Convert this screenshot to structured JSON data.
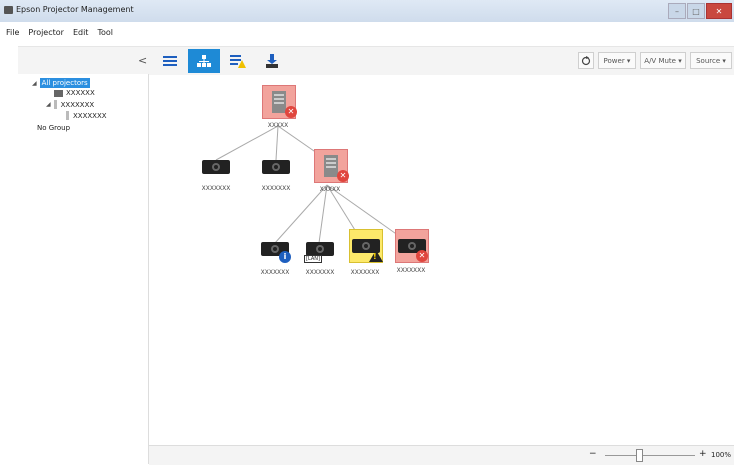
{
  "window": {
    "title": "Epson Projector Management"
  },
  "menu": [
    "File",
    "Projector",
    "Edit",
    "Tool"
  ],
  "toolbar": {
    "collapse_glyph": "<",
    "views": [
      "list-view-icon",
      "topology-view-icon",
      "alert-view-icon",
      "download-icon"
    ],
    "power": "Power ▾",
    "av_mute": "A/V Mute ▾",
    "source": "Source ▾"
  },
  "sidebar": {
    "root": "All projectors",
    "items": [
      {
        "label": "XXXXXX"
      },
      {
        "label": "XXXXXXX"
      },
      {
        "label": "XXXXXXX"
      }
    ],
    "no_group": "No Group"
  },
  "topology": {
    "nodes": [
      {
        "label": "XXXXX"
      },
      {
        "label": "XXXXXXX"
      },
      {
        "label": "XXXXXXX"
      },
      {
        "label": "XXXXX"
      },
      {
        "label": "XXXXXXX"
      },
      {
        "label": "XXXXXXX",
        "badge": "[LAN]"
      },
      {
        "label": "XXXXXXX"
      },
      {
        "label": "XXXXXXX"
      }
    ]
  },
  "zoom": {
    "minus": "−",
    "plus": "+",
    "value": "100%"
  },
  "colors": {
    "accent": "#1e8ad6",
    "error_bg": "#f2a39c",
    "warn_bg": "#fde96a"
  }
}
